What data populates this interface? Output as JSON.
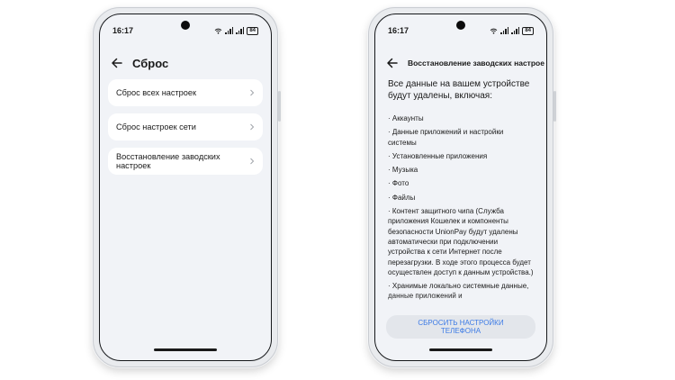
{
  "left_phone": {
    "status": {
      "time": "16:17",
      "battery": "84"
    },
    "title": "Сброс",
    "items": [
      {
        "label": "Сброс всех настроек"
      },
      {
        "label": "Сброс настроек сети"
      },
      {
        "label": "Восстановление заводских настроек"
      }
    ]
  },
  "right_phone": {
    "status": {
      "time": "16:17",
      "battery": "84"
    },
    "title": "Восстановление заводских настроек",
    "intro": "Все данные на вашем устройстве будут удалены, включая:",
    "list": [
      "Аккаунты",
      "Данные приложений и настройки системы",
      "Установленные приложения",
      "Музыка",
      "Фото",
      "Файлы",
      "Контент защитного чипа (Служба приложения Кошелек и компоненты безопасности UnionPay будут удалены автоматически при подключении устройства к сети Интернет после перезагрузки. В ходе этого процесса будет осуществлен доступ к данным устройства.)",
      "Хранимые локально системные данные, данные приложений и"
    ],
    "reset_button": "СБРОСИТЬ НАСТРОЙКИ ТЕЛЕФОНА"
  },
  "icons": {
    "back": "arrow-left-icon",
    "chevron": "chevron-right-icon",
    "wifi": "wifi-icon",
    "signal": "signal-icon",
    "battery": "battery-icon"
  },
  "colors": {
    "accent": "#3d7be6",
    "screen_bg": "#f1f3f7",
    "card_bg": "#ffffff"
  }
}
